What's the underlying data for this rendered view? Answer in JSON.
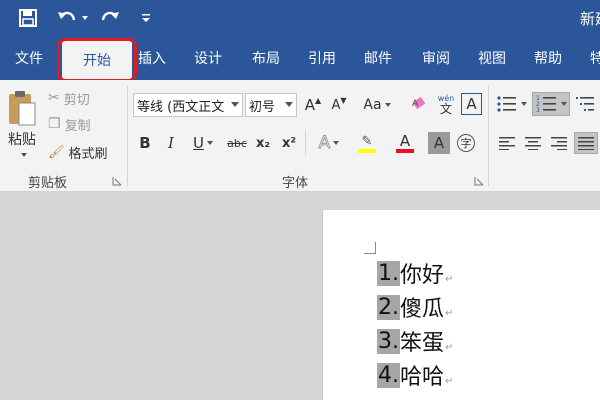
{
  "window": {
    "title": "新建"
  },
  "tabs": [
    "文件",
    "开始",
    "插入",
    "设计",
    "布局",
    "引用",
    "邮件",
    "审阅",
    "视图",
    "帮助",
    "特"
  ],
  "clipboard": {
    "paste_label": "粘贴",
    "cut_label": "剪切",
    "copy_label": "复制",
    "format_painter_label": "格式刷",
    "group_label": "剪贴板"
  },
  "font": {
    "font_name": "等线 (西文正文",
    "font_size": "初号",
    "grow_label": "A",
    "shrink_label": "A",
    "case_label": "Aa",
    "phonetic_top": "wén",
    "phonetic_bottom": "文",
    "border_label": "A",
    "bold_label": "B",
    "italic_label": "I",
    "underline_label": "U",
    "strike_label": "abc",
    "subscript_label": "x₂",
    "superscript_label": "x²",
    "text_effect_label": "A",
    "font_color_label": "A",
    "char_shading_label": "A",
    "enclose_label": "字",
    "group_label": "字体",
    "font_color": "#e81123",
    "highlight_color": "#ffff00"
  },
  "document": {
    "items": [
      {
        "num": "1.",
        "text": "你好"
      },
      {
        "num": "2.",
        "text": "傻瓜"
      },
      {
        "num": "3.",
        "text": "笨蛋"
      },
      {
        "num": "4.",
        "text": "哈哈"
      }
    ],
    "para_mark": "↵"
  },
  "colors": {
    "ribbon_blue": "#2b579a",
    "highlight_red": "#e11b22",
    "selection_gray": "#a6a6a6"
  }
}
